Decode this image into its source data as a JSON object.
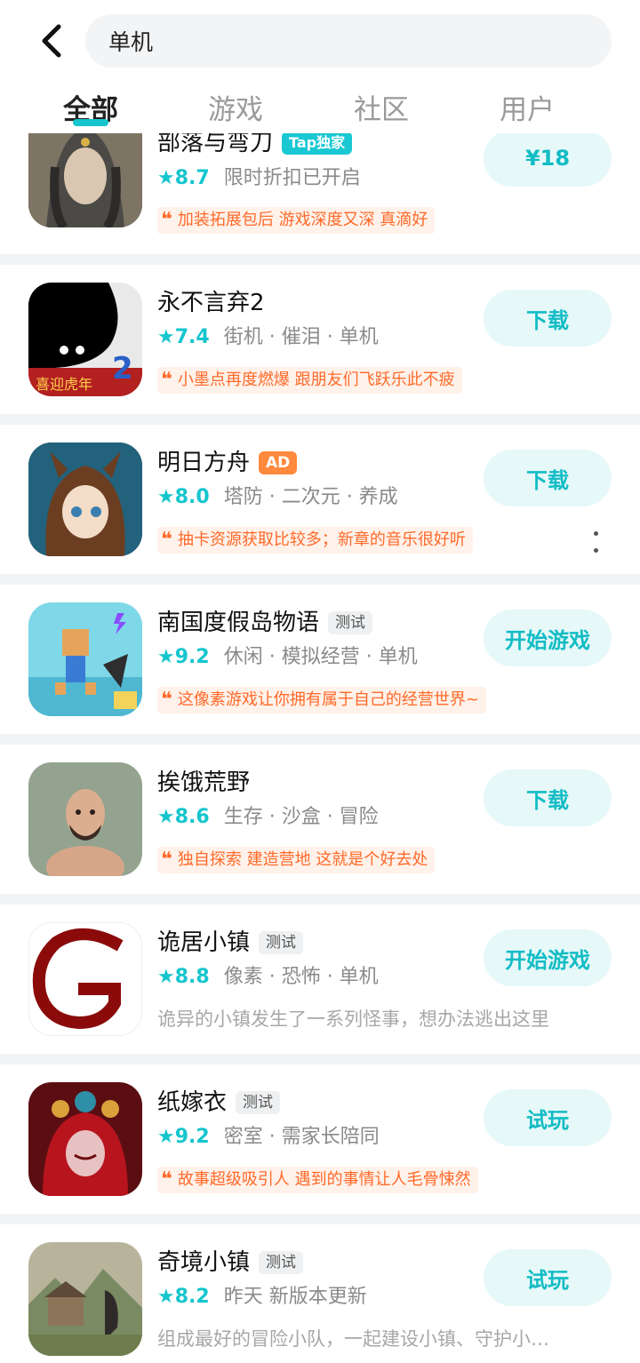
{
  "search": {
    "value": "单机"
  },
  "tabs": [
    {
      "label": "全部",
      "active": true
    },
    {
      "label": "游戏",
      "active": false
    },
    {
      "label": "社区",
      "active": false
    },
    {
      "label": "用户",
      "active": false
    }
  ],
  "colors": {
    "accent": "#15c5ce",
    "quote": "#ff6a2a",
    "button_bg": "#e6f8f8"
  },
  "games": [
    {
      "title": "部落与弯刀",
      "badge": "Tap独家",
      "badge_type": "tap",
      "rating": "8.7",
      "tags": "限时折扣已开启",
      "quote": "加装拓展包后 游戏深度又深 真滴好",
      "action": "¥18"
    },
    {
      "title": "永不言弃2",
      "badge": "",
      "badge_type": "",
      "rating": "7.4",
      "tags": "街机 · 催泪 · 单机",
      "quote": "小墨点再度燃爆 跟朋友们飞跃乐此不疲",
      "action": "下载"
    },
    {
      "title": "明日方舟",
      "badge": "AD",
      "badge_type": "ad",
      "rating": "8.0",
      "tags": "塔防 · 二次元 · 养成",
      "quote": "抽卡资源获取比较多；新章的音乐很好听",
      "action": "下载"
    },
    {
      "title": "南国度假岛物语",
      "badge": "测试",
      "badge_type": "test",
      "rating": "9.2",
      "tags": "休闲 · 模拟经营 · 单机",
      "quote": "这像素游戏让你拥有属于自己的经营世界~",
      "action": "开始游戏"
    },
    {
      "title": "挨饿荒野",
      "badge": "",
      "badge_type": "",
      "rating": "8.6",
      "tags": "生存 · 沙盒 · 冒险",
      "quote": "独自探索 建造营地 这就是个好去处",
      "action": "下载"
    },
    {
      "title": "诡居小镇",
      "badge": "测试",
      "badge_type": "test",
      "rating": "8.8",
      "tags": "像素 · 恐怖 · 单机",
      "desc": "诡异的小镇发生了一系列怪事，想办法逃出这里",
      "action": "开始游戏"
    },
    {
      "title": "纸嫁衣",
      "badge": "测试",
      "badge_type": "test",
      "rating": "9.2",
      "tags": "密室 · 需家长陪同",
      "quote": "故事超级吸引人 遇到的事情让人毛骨悚然",
      "action": "试玩"
    },
    {
      "title": "奇境小镇",
      "badge": "测试",
      "badge_type": "test",
      "rating": "8.2",
      "tags": "昨天 新版本更新",
      "desc": "组成最好的冒险小队，一起建设小镇、守护小…",
      "action": "试玩"
    }
  ]
}
